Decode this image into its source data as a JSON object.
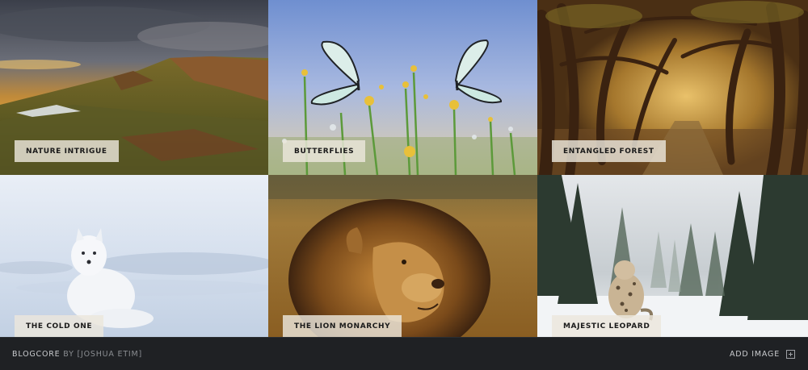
{
  "gallery": {
    "tiles": [
      {
        "caption": "NATURE INTRIGUE",
        "image": "mountain-sunset-landscape"
      },
      {
        "caption": "BUTTERFLIES",
        "image": "butterflies-on-flowers"
      },
      {
        "caption": "ENTANGLED FOREST",
        "image": "twisted-tree-tunnel"
      },
      {
        "caption": "THE COLD ONE",
        "image": "arctic-fox-in-snow"
      },
      {
        "caption": "THE LION MONARCHY",
        "image": "lion-in-grass"
      },
      {
        "caption": "MAJESTIC LEOPARD",
        "image": "snow-leopard-in-forest"
      }
    ]
  },
  "footer": {
    "brand": "BLOGCORE",
    "by": "BY",
    "author": "[JOSHUA ETIM]",
    "add_image_label": "ADD IMAGE",
    "add_image_icon": "plus-square-icon"
  }
}
